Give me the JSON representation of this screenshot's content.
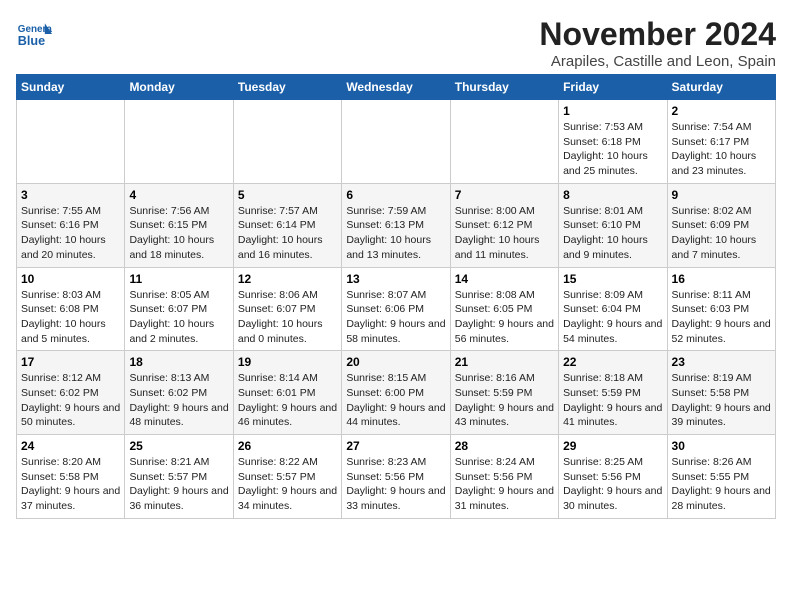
{
  "header": {
    "logo_general": "General",
    "logo_blue": "Blue",
    "month_title": "November 2024",
    "location": "Arapiles, Castille and Leon, Spain"
  },
  "calendar": {
    "days_of_week": [
      "Sunday",
      "Monday",
      "Tuesday",
      "Wednesday",
      "Thursday",
      "Friday",
      "Saturday"
    ],
    "weeks": [
      [
        {
          "day": "",
          "info": ""
        },
        {
          "day": "",
          "info": ""
        },
        {
          "day": "",
          "info": ""
        },
        {
          "day": "",
          "info": ""
        },
        {
          "day": "",
          "info": ""
        },
        {
          "day": "1",
          "info": "Sunrise: 7:53 AM\nSunset: 6:18 PM\nDaylight: 10 hours and 25 minutes."
        },
        {
          "day": "2",
          "info": "Sunrise: 7:54 AM\nSunset: 6:17 PM\nDaylight: 10 hours and 23 minutes."
        }
      ],
      [
        {
          "day": "3",
          "info": "Sunrise: 7:55 AM\nSunset: 6:16 PM\nDaylight: 10 hours and 20 minutes."
        },
        {
          "day": "4",
          "info": "Sunrise: 7:56 AM\nSunset: 6:15 PM\nDaylight: 10 hours and 18 minutes."
        },
        {
          "day": "5",
          "info": "Sunrise: 7:57 AM\nSunset: 6:14 PM\nDaylight: 10 hours and 16 minutes."
        },
        {
          "day": "6",
          "info": "Sunrise: 7:59 AM\nSunset: 6:13 PM\nDaylight: 10 hours and 13 minutes."
        },
        {
          "day": "7",
          "info": "Sunrise: 8:00 AM\nSunset: 6:12 PM\nDaylight: 10 hours and 11 minutes."
        },
        {
          "day": "8",
          "info": "Sunrise: 8:01 AM\nSunset: 6:10 PM\nDaylight: 10 hours and 9 minutes."
        },
        {
          "day": "9",
          "info": "Sunrise: 8:02 AM\nSunset: 6:09 PM\nDaylight: 10 hours and 7 minutes."
        }
      ],
      [
        {
          "day": "10",
          "info": "Sunrise: 8:03 AM\nSunset: 6:08 PM\nDaylight: 10 hours and 5 minutes."
        },
        {
          "day": "11",
          "info": "Sunrise: 8:05 AM\nSunset: 6:07 PM\nDaylight: 10 hours and 2 minutes."
        },
        {
          "day": "12",
          "info": "Sunrise: 8:06 AM\nSunset: 6:07 PM\nDaylight: 10 hours and 0 minutes."
        },
        {
          "day": "13",
          "info": "Sunrise: 8:07 AM\nSunset: 6:06 PM\nDaylight: 9 hours and 58 minutes."
        },
        {
          "day": "14",
          "info": "Sunrise: 8:08 AM\nSunset: 6:05 PM\nDaylight: 9 hours and 56 minutes."
        },
        {
          "day": "15",
          "info": "Sunrise: 8:09 AM\nSunset: 6:04 PM\nDaylight: 9 hours and 54 minutes."
        },
        {
          "day": "16",
          "info": "Sunrise: 8:11 AM\nSunset: 6:03 PM\nDaylight: 9 hours and 52 minutes."
        }
      ],
      [
        {
          "day": "17",
          "info": "Sunrise: 8:12 AM\nSunset: 6:02 PM\nDaylight: 9 hours and 50 minutes."
        },
        {
          "day": "18",
          "info": "Sunrise: 8:13 AM\nSunset: 6:02 PM\nDaylight: 9 hours and 48 minutes."
        },
        {
          "day": "19",
          "info": "Sunrise: 8:14 AM\nSunset: 6:01 PM\nDaylight: 9 hours and 46 minutes."
        },
        {
          "day": "20",
          "info": "Sunrise: 8:15 AM\nSunset: 6:00 PM\nDaylight: 9 hours and 44 minutes."
        },
        {
          "day": "21",
          "info": "Sunrise: 8:16 AM\nSunset: 5:59 PM\nDaylight: 9 hours and 43 minutes."
        },
        {
          "day": "22",
          "info": "Sunrise: 8:18 AM\nSunset: 5:59 PM\nDaylight: 9 hours and 41 minutes."
        },
        {
          "day": "23",
          "info": "Sunrise: 8:19 AM\nSunset: 5:58 PM\nDaylight: 9 hours and 39 minutes."
        }
      ],
      [
        {
          "day": "24",
          "info": "Sunrise: 8:20 AM\nSunset: 5:58 PM\nDaylight: 9 hours and 37 minutes."
        },
        {
          "day": "25",
          "info": "Sunrise: 8:21 AM\nSunset: 5:57 PM\nDaylight: 9 hours and 36 minutes."
        },
        {
          "day": "26",
          "info": "Sunrise: 8:22 AM\nSunset: 5:57 PM\nDaylight: 9 hours and 34 minutes."
        },
        {
          "day": "27",
          "info": "Sunrise: 8:23 AM\nSunset: 5:56 PM\nDaylight: 9 hours and 33 minutes."
        },
        {
          "day": "28",
          "info": "Sunrise: 8:24 AM\nSunset: 5:56 PM\nDaylight: 9 hours and 31 minutes."
        },
        {
          "day": "29",
          "info": "Sunrise: 8:25 AM\nSunset: 5:56 PM\nDaylight: 9 hours and 30 minutes."
        },
        {
          "day": "30",
          "info": "Sunrise: 8:26 AM\nSunset: 5:55 PM\nDaylight: 9 hours and 28 minutes."
        }
      ]
    ]
  }
}
